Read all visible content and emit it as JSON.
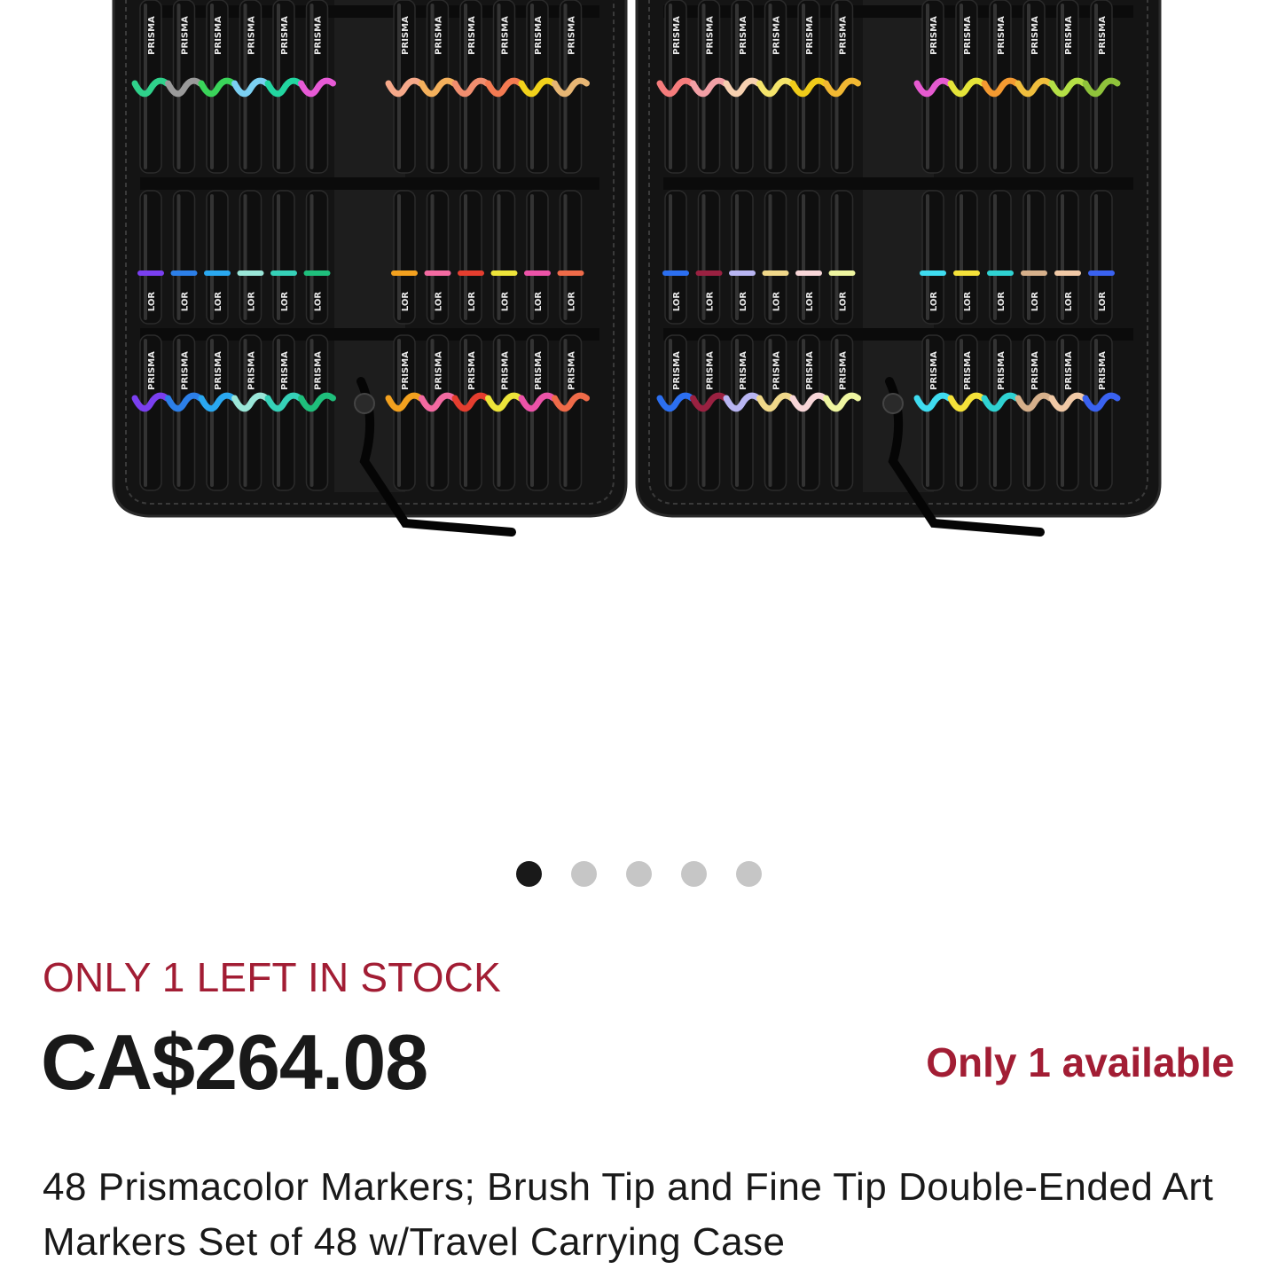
{
  "gallery": {
    "image_alt": "48 Prismacolor markers in open black zip travel case",
    "marker_brand": "PRISMA",
    "marker_brand_side": "LOR",
    "dots_total": 5,
    "active_dot": 1,
    "marker_colors": [
      [
        "#2fd18b",
        "#9a9a9a",
        "#3ad45a",
        "#7bd0f2",
        "#22d6a0",
        "#e75ad6",
        "#f6a98a",
        "#f4b05c",
        "#f08e6f",
        "#f47b52",
        "#f2d21b",
        "#e7b674"
      ],
      [
        "#7a3ff0",
        "#2c7fe8",
        "#2aa8f0",
        "#9ae6d8",
        "#36d1b8",
        "#1fbf7c",
        "#f3a11f",
        "#f36aa1",
        "#e53e2f",
        "#ede43a",
        "#ec53a8",
        "#ef6b49"
      ],
      [
        "#f57c7c",
        "#f2a0a6",
        "#f6d0b0",
        "#f4e46b",
        "#f0cc1a",
        "#f1b832",
        "#e65ad0",
        "#e4e439",
        "#f49a31",
        "#f0be3d",
        "#b4e046",
        "#8fc33b"
      ],
      [
        "#2c6ff0",
        "#9a2141",
        "#b8b5f2",
        "#f0d88a",
        "#f8d6d8",
        "#eef5a0",
        "#3fdcf0",
        "#f5e23a",
        "#2fd2d2",
        "#d6b08b",
        "#f1c9a6",
        "#3a62f0"
      ]
    ]
  },
  "stock_banner": "ONLY 1 LEFT IN STOCK",
  "price": "CA$264.08",
  "availability": "Only 1 available",
  "title": "48 Prismacolor Markers; Brush Tip and Fine Tip Double-Ended Art Markers Set of 48 w/Travel Carrying Case",
  "colors": {
    "accent_red": "#a21d34",
    "text_dark": "#191919",
    "dot_inactive": "#c6c6c6",
    "dot_active": "#191919"
  }
}
